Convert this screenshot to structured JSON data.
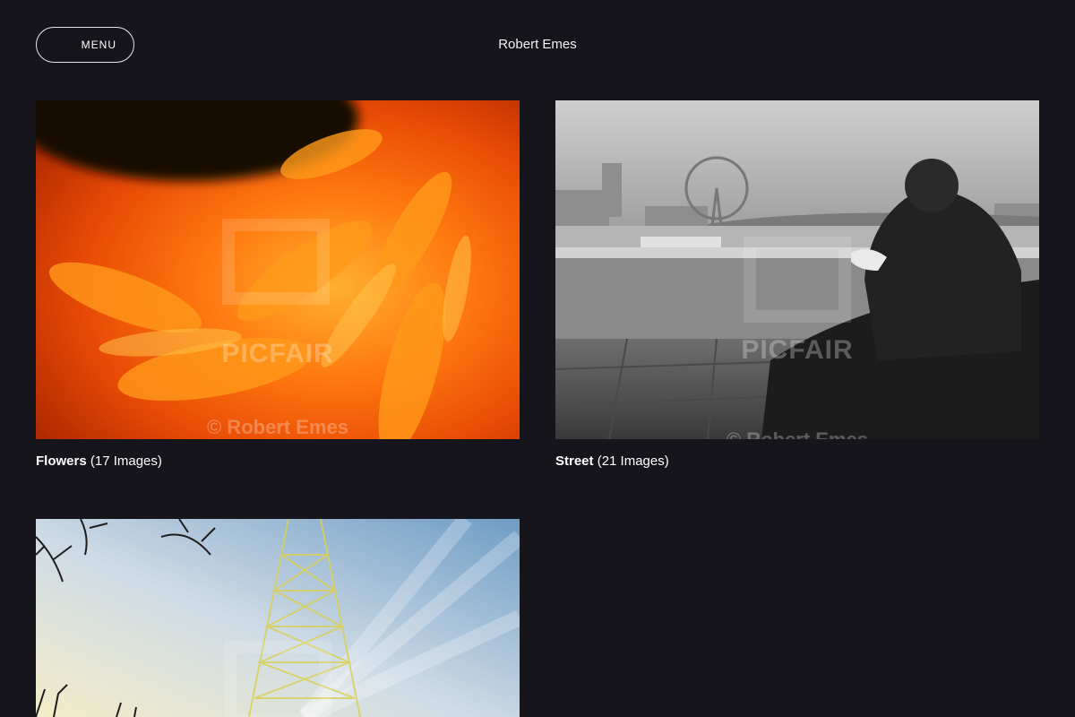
{
  "header": {
    "menu_label": "MENU",
    "site_title": "Robert Emes"
  },
  "galleries": [
    {
      "name": "Flowers",
      "count": "(17 Images)",
      "watermark": "PICFAIR",
      "copyright": "© Robert Emes"
    },
    {
      "name": "Street",
      "count": "(21 Images)",
      "watermark": "PICFAIR",
      "copyright": "© Robert Emes"
    },
    {
      "name": "",
      "count": ""
    }
  ],
  "colors": {
    "background": "#16151c",
    "text": "#ffffff"
  }
}
